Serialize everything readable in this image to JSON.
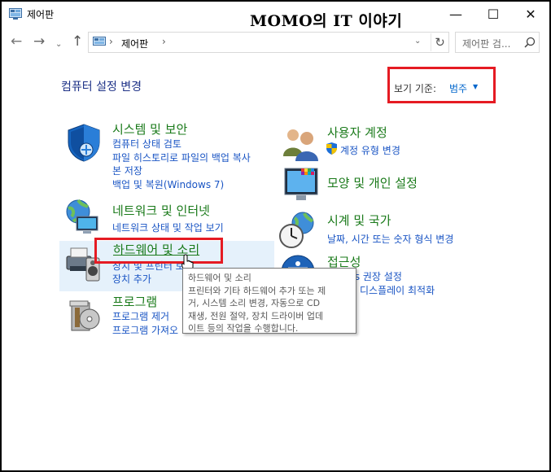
{
  "window": {
    "title": "제어판"
  },
  "watermark": "MOMO의 IT 이야기",
  "title_buttons": {
    "minimize": "—",
    "maximize": "☐",
    "close": "✕"
  },
  "nav": {
    "back": "←",
    "forward": "→",
    "recent": "⌄",
    "up": "↑",
    "sep": "›",
    "dropdown": "⌄",
    "refresh": "↻"
  },
  "address": {
    "path": "제어판"
  },
  "search": {
    "placeholder": "제어판 검..."
  },
  "header": {
    "title": "컴퓨터 설정 변경",
    "view_by_label": "보기 기준:",
    "view_by_value": "범주",
    "caret": "▼"
  },
  "categories": {
    "system": {
      "title": "시스템 및 보안",
      "links": [
        "컴퓨터 상태 검토",
        "파일 히스토리로 파일의 백업 복사",
        "본 저장",
        "백업 및 복원(Windows 7)"
      ]
    },
    "network": {
      "title": "네트워크 및 인터넷",
      "links": [
        "네트워크 상태 및 작업 보기"
      ]
    },
    "hardware": {
      "title": "하드웨어 및 소리",
      "links": [
        "장치 및 프린터 보기",
        "장치 추가"
      ]
    },
    "programs": {
      "title": "프로그램",
      "links": [
        "프로그램 제거",
        "프로그램 가져오"
      ]
    },
    "user": {
      "title": "사용자 계정",
      "links": [
        "계정 유형 변경"
      ]
    },
    "appearance": {
      "title": "모양 및 개인 설정"
    },
    "clock": {
      "title": "시계 및 국가",
      "links": [
        "날짜, 시간 또는 숫자 형식 변경"
      ]
    },
    "access": {
      "title": "접근성",
      "links": [
        "ws 권장 설정",
        "디스플레이 최적화"
      ]
    }
  },
  "tooltip": {
    "lines": [
      "하드웨어 및 소리",
      "프린터와 기타 하드웨어 추가 또는 제",
      "거, 시스템 소리 변경, 자동으로 CD",
      "재생, 전원 절약, 장치 드라이버 업데",
      "이트 등의 작업을 수행합니다."
    ]
  },
  "colors": {
    "category_title": "#1a7a1a",
    "link": "#1a55c4",
    "highlight": "#e51b23",
    "hover": "#e5f1fb"
  }
}
